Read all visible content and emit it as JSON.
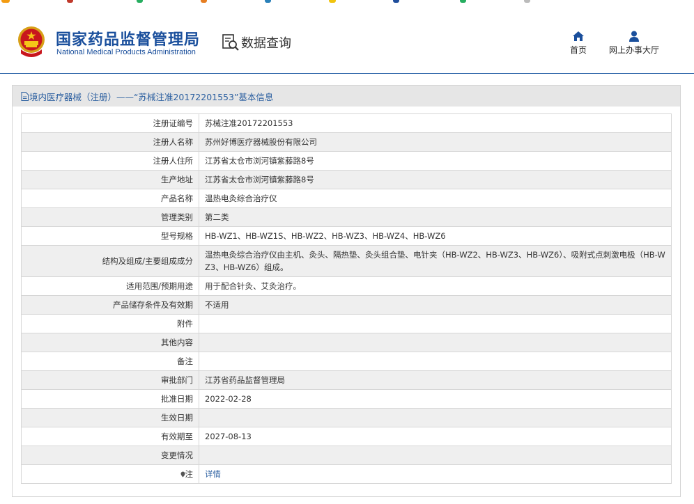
{
  "header": {
    "logo_cn": "国家药品监督管理局",
    "logo_en": "National Medical Products Administration",
    "section_title": "数据查询",
    "nav": [
      {
        "label": "首页",
        "icon": "home-icon"
      },
      {
        "label": "网上办事大厅",
        "icon": "user-icon"
      }
    ]
  },
  "panel": {
    "title": "境内医疗器械（注册）——“苏械注准20172201553”基本信息"
  },
  "rows": [
    {
      "key": "注册证编号",
      "value": "苏械注准20172201553"
    },
    {
      "key": "注册人名称",
      "value": "苏州好博医疗器械股份有限公司"
    },
    {
      "key": "注册人住所",
      "value": "江苏省太仓市浏河镇紫藤路8号"
    },
    {
      "key": "生产地址",
      "value": "江苏省太仓市浏河镇紫藤路8号"
    },
    {
      "key": "产品名称",
      "value": "温热电灸综合治疗仪"
    },
    {
      "key": "管理类别",
      "value": "第二类"
    },
    {
      "key": "型号规格",
      "value": "HB-WZ1、HB-WZ1S、HB-WZ2、HB-WZ3、HB-WZ4、HB-WZ6"
    },
    {
      "key": "结构及组成/主要组成成分",
      "value": "温热电灸综合治疗仪由主机、灸头、隔热垫、灸头组合垫、电针夹（HB-WZ2、HB-WZ3、HB-WZ6）、吸附式点刺激电极（HB-WZ3、HB-WZ6）组成。"
    },
    {
      "key": "适用范围/预期用途",
      "value": "用于配合针灸、艾灸治疗。"
    },
    {
      "key": "产品储存条件及有效期",
      "value": "不适用"
    },
    {
      "key": "附件",
      "value": ""
    },
    {
      "key": "其他内容",
      "value": ""
    },
    {
      "key": "备注",
      "value": ""
    },
    {
      "key": "审批部门",
      "value": "江苏省药品监督管理局"
    },
    {
      "key": "批准日期",
      "value": "2022-02-28"
    },
    {
      "key": "生效日期",
      "value": ""
    },
    {
      "key": "有效期至",
      "value": "2027-08-13"
    },
    {
      "key": "变更情况",
      "value": ""
    }
  ],
  "note_row": {
    "key": "注",
    "value": "详情",
    "icon": "pin-icon"
  },
  "colors": {
    "brand_blue": "#1a4f9c",
    "link_blue": "#2b5fa0",
    "header_rule": "#2a63a8",
    "row_alt": "#efefef"
  }
}
